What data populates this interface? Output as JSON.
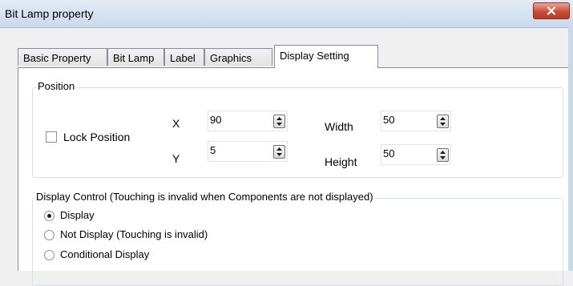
{
  "window": {
    "title": "Bit Lamp property",
    "close_icon": "close-icon",
    "close_color": "#c94f3a"
  },
  "tabs": [
    {
      "label": "Basic Property"
    },
    {
      "label": "Bit Lamp"
    },
    {
      "label": "Label"
    },
    {
      "label": "Graphics"
    },
    {
      "label": "Display Setting",
      "active": true
    }
  ],
  "position": {
    "legend": "Position",
    "lock_label": "Lock Position",
    "lock_checked": false,
    "x_label": "X",
    "x_value": "90",
    "y_label": "Y",
    "y_value": "5",
    "width_label": "Width",
    "width_value": "50",
    "height_label": "Height",
    "height_value": "50"
  },
  "display_control": {
    "legend": "Display Control (Touching is invalid when Components are not displayed)",
    "options": [
      {
        "label": "Display",
        "selected": true
      },
      {
        "label": "Not Display (Touching is invalid)",
        "selected": false
      },
      {
        "label": "Conditional Display",
        "selected": false
      }
    ]
  }
}
